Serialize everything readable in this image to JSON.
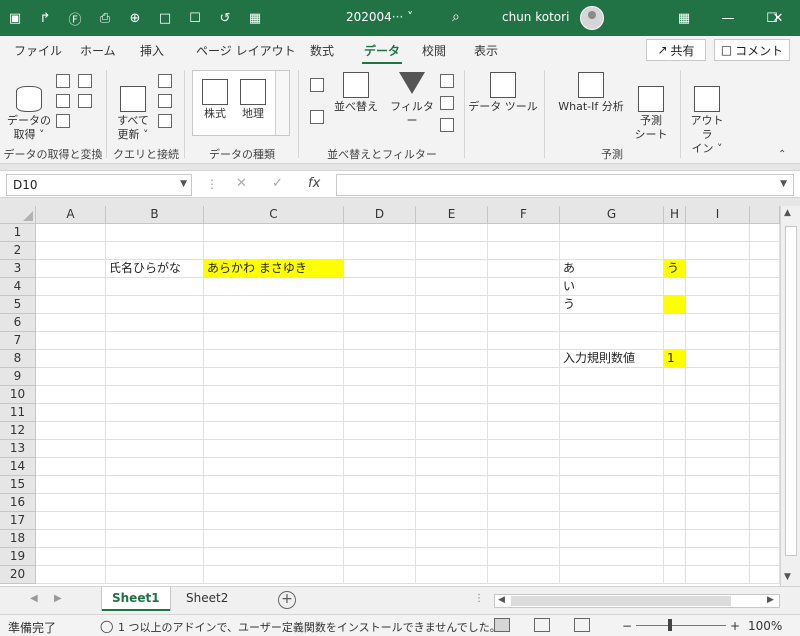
{
  "titlebar": {
    "doc_title": "202004···  ˅",
    "user_name": "chun kotori",
    "quick_icons": [
      "▣",
      "↱",
      "Ⓕ",
      "⎙",
      "⊕",
      "□",
      "☐",
      "↺",
      "▦"
    ],
    "win_min": "—",
    "win_max": "☐",
    "win_close": "✕",
    "search_glyph": "⌕"
  },
  "tabs": [
    {
      "label": "ファイル"
    },
    {
      "label": "ホーム"
    },
    {
      "label": "挿入"
    },
    {
      "label": "ページ レイアウト"
    },
    {
      "label": "数式"
    },
    {
      "label": "データ"
    },
    {
      "label": "校閲"
    },
    {
      "label": "表示"
    }
  ],
  "share_label": "共有",
  "comment_label": "コメント",
  "ribbon": {
    "get_data": "データの\n取得 ˅",
    "refresh_all": "すべて\n更新 ˅",
    "stocks": "株式",
    "geography": "地理",
    "sort": "並べ替え",
    "filter": "フィルター",
    "data_tools": "データ ツール",
    "what_if": "What-If 分析",
    "forecast": "予測\nシート",
    "outline": "アウトラ\nイン ˅",
    "groups": {
      "get_transform": "データの取得と変換",
      "queries": "クエリと接続",
      "data_types": "データの種類",
      "sort_filter": "並べ替えとフィルター",
      "forecast": "予測"
    }
  },
  "formula_bar": {
    "name_box": "D10",
    "cancel_glyph": "✕",
    "enter_glyph": "✓",
    "fx_glyph": "fx",
    "formula": ""
  },
  "columns": [
    "A",
    "B",
    "C",
    "D",
    "E",
    "F",
    "G",
    "H",
    "I"
  ],
  "rows": [
    "1",
    "2",
    "3",
    "4",
    "5",
    "6",
    "7",
    "8",
    "9",
    "10",
    "11",
    "12",
    "13",
    "14",
    "15",
    "16",
    "17",
    "18",
    "19",
    "20"
  ],
  "cells": {
    "B3": "氏名ひらがな",
    "C3": "あらかわ  まさゆき",
    "G3": "あ",
    "H3": "う",
    "G4": "い",
    "G5": "う",
    "H5": "",
    "G8": "入力規則数値",
    "H8": "1"
  },
  "highlight_color": "#ffff00",
  "accent_color": "#217346",
  "sheets": [
    {
      "label": "Sheet1",
      "active": true
    },
    {
      "label": "Sheet2",
      "active": false
    }
  ],
  "status": {
    "ready": "準備完了",
    "message": "1 つ以上のアドインで、ユーザー定義関数をインストールできませんでした。",
    "zoom": "100%"
  }
}
